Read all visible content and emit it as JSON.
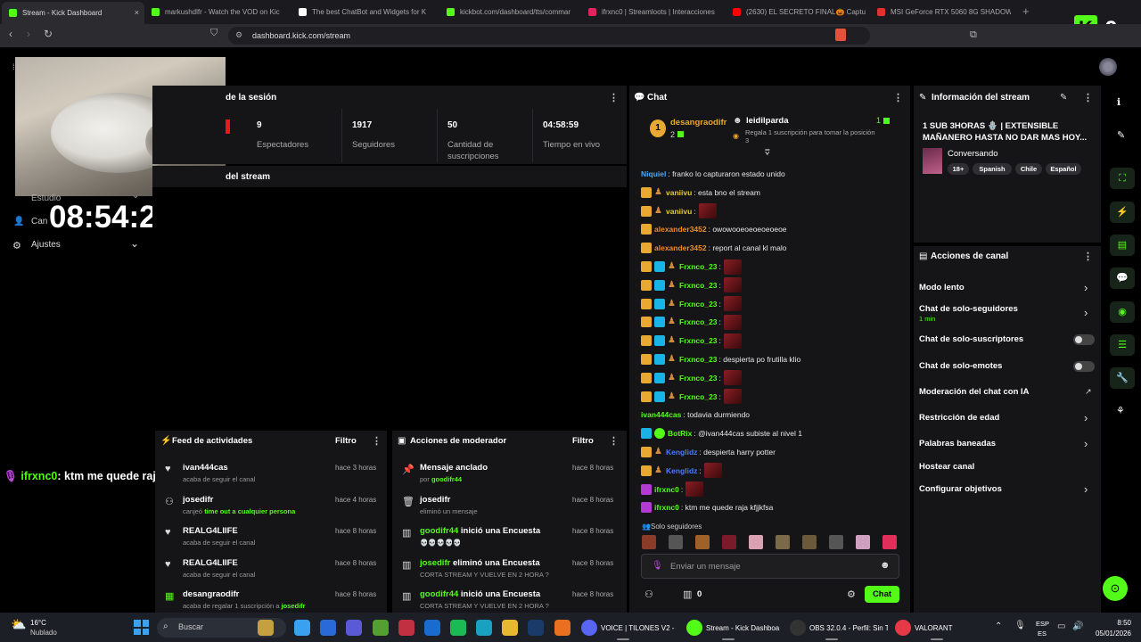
{
  "browser": {
    "tabs": [
      {
        "title": "Stream - Kick Dashboard",
        "color": "#53fc18"
      },
      {
        "title": "markushdlfr - Watch the VOD on Kic",
        "color": "#53fc18"
      },
      {
        "title": "The best ChatBot and Widgets for K",
        "color": "#ffffff"
      },
      {
        "title": "kickbot.com/dashboard/tts/commar",
        "color": "#53fc18"
      },
      {
        "title": "ifrxnc0 | Streamloots | Interacciones",
        "color": "#e0245e"
      },
      {
        "title": "(2630) EL SECRETO FINAL🎃 Captu",
        "color": "#ff0000"
      },
      {
        "title": "MSI GeForce RTX 5060 8G SHADOW",
        "color": "#e03030"
      }
    ],
    "tab_close": "×",
    "new_tab": "+",
    "url": "dashboard.kick.com/stream",
    "brand_icon_text": "K",
    "brand_number": "9"
  },
  "session": {
    "title": "de la sesión",
    "stats": [
      {
        "value": "9",
        "label": "Espectadores"
      },
      {
        "value": "1917",
        "label": "Seguidores"
      },
      {
        "value": "50",
        "label": "Cantidad de suscripciones"
      },
      {
        "value": "04:58:59",
        "label": "Tiempo en vivo"
      }
    ],
    "preview_title": "del stream"
  },
  "overlay": {
    "clock": "08:54:29",
    "left_menu": [
      {
        "label": "Estudio"
      },
      {
        "label": "Can"
      },
      {
        "label": "Ajustes"
      }
    ]
  },
  "overlay_chat_line": {
    "user": "ifrxnc0",
    "text": ": ktm me quede raja kfjjkfsa"
  },
  "chat": {
    "title": "Chat",
    "pinned": {
      "rank": "1",
      "user": "desangraodifr",
      "count": "2",
      "target": "leidilparda",
      "target_count": "1",
      "gift_text": "Regala 1 suscripción para tomar la posición 3"
    },
    "messages": [
      {
        "user": "Niquiel",
        "color": "#4aa8ff",
        "text": ": franko lo capturaron estado unido",
        "badges": []
      },
      {
        "user": "vaniivu",
        "color": "#e8c832",
        "text": ": esta bno el stream",
        "badges": [
          "crown",
          "fig"
        ]
      },
      {
        "user": "vaniivu",
        "color": "#e8c832",
        "text": ":",
        "badges": [
          "crown",
          "fig"
        ],
        "emote": true
      },
      {
        "user": "alexander3452",
        "color": "#f08a24",
        "text": ": owowooeoeoeoeoeoe",
        "badges": [
          "crown"
        ]
      },
      {
        "user": "alexander3452",
        "color": "#f08a24",
        "text": ": report al canal kl malo",
        "badges": [
          "crown"
        ]
      },
      {
        "user": "Frxnco_23",
        "color": "#53fc18",
        "text": ":",
        "badges": [
          "crown",
          "sub",
          "fig"
        ],
        "emote": true
      },
      {
        "user": "Frxnco_23",
        "color": "#53fc18",
        "text": ":",
        "badges": [
          "crown",
          "sub",
          "fig"
        ],
        "emote": true
      },
      {
        "user": "Frxnco_23",
        "color": "#53fc18",
        "text": ":",
        "badges": [
          "crown",
          "sub",
          "fig"
        ],
        "emote": true
      },
      {
        "user": "Frxnco_23",
        "color": "#53fc18",
        "text": ":",
        "badges": [
          "crown",
          "sub",
          "fig"
        ],
        "emote": true
      },
      {
        "user": "Frxnco_23",
        "color": "#53fc18",
        "text": ":",
        "badges": [
          "crown",
          "sub",
          "fig"
        ],
        "emote": true
      },
      {
        "user": "Frxnco_23",
        "color": "#53fc18",
        "text": ": despierta po frutilla klio",
        "badges": [
          "crown",
          "sub",
          "fig"
        ]
      },
      {
        "user": "Frxnco_23",
        "color": "#53fc18",
        "text": ":",
        "badges": [
          "crown",
          "sub",
          "fig"
        ],
        "emote": true
      },
      {
        "user": "Frxnco_23",
        "color": "#53fc18",
        "text": ":",
        "badges": [
          "crown",
          "sub",
          "fig"
        ],
        "emote": true
      },
      {
        "user": "ivan444cas",
        "color": "#53fc18",
        "text": ": todavia durmiendo",
        "badges": []
      },
      {
        "user": "BotRix",
        "color": "#53fc18",
        "text": ": @ivan444cas subiste al nivel 1",
        "badges": [
          "bot",
          "check"
        ]
      },
      {
        "user": "Kenglidz",
        "color": "#4a7aff",
        "text": ": despierta harry potter",
        "badges": [
          "crown",
          "fig"
        ]
      },
      {
        "user": "Kenglidz",
        "color": "#4a7aff",
        "text": ":",
        "badges": [
          "crown",
          "fig"
        ],
        "emote": true
      },
      {
        "user": "ifrxnc0",
        "color": "#53fc18",
        "text": ":",
        "badges": [
          "mic"
        ],
        "emote": true
      },
      {
        "user": "ifrxnc0",
        "color": "#53fc18",
        "text": ": ktm me quede raja kfjjkfsa",
        "badges": [
          "mic"
        ]
      }
    ],
    "followers_only": "Solo seguidores",
    "input_placeholder": "Enviar un mensaje",
    "points": "0",
    "send_label": "Chat"
  },
  "stream_info": {
    "title": "Información del stream",
    "stream_title": "1 SUB 3HORAS 🪬 | EXTENSIBLE MAÑANERO HASTA NO DAR MAS HOY...",
    "category": "Conversando",
    "tags": [
      "18+",
      "Spanish",
      "Chile",
      "Español"
    ]
  },
  "channel_actions": {
    "title": "Acciones de canal",
    "items": [
      {
        "label": "Modo lento",
        "control": "chevron"
      },
      {
        "label": "Chat de solo-seguidores",
        "sub": "1 min",
        "control": "chevron"
      },
      {
        "label": "Chat de solo-suscriptores",
        "control": "toggle"
      },
      {
        "label": "Chat de solo-emotes",
        "control": "toggle"
      },
      {
        "label": "Moderación del chat con IA",
        "control": "external"
      },
      {
        "label": "Restricción de edad",
        "control": "chevron"
      },
      {
        "label": "Palabras baneadas",
        "control": "chevron"
      },
      {
        "label": "Hostear canal",
        "control": "none"
      },
      {
        "label": "Configurar objetivos",
        "control": "chevron"
      }
    ]
  },
  "activity_feed": {
    "title": "Feed de actividades",
    "filter": "Filtro",
    "items": [
      {
        "icon": "heart",
        "name": "ivan444cas",
        "desc": "acaba de seguir el canal",
        "time": "hace 3 horas"
      },
      {
        "icon": "users",
        "name": "josedifr",
        "desc": "canjeó ",
        "highlight": "time out a cualquier persona",
        "time": "hace 4 horas"
      },
      {
        "icon": "heart",
        "name": "REALG4LIIFE",
        "desc": "acaba de seguir el canal",
        "time": "hace 8 horas"
      },
      {
        "icon": "heart",
        "name": "REALG4LIIFE",
        "desc": "acaba de seguir el canal",
        "time": "hace 8 horas"
      },
      {
        "icon": "gift",
        "name": "desangraodifr",
        "desc": "acaba de regalar 1 suscripción a ",
        "highlight": "josedifr",
        "time": "hace 8 horas"
      }
    ]
  },
  "mod_actions": {
    "title": "Acciones de moderador",
    "filter": "Filtro",
    "items": [
      {
        "icon": "pin",
        "name": "Mensaje anclado",
        "name_highlight": false,
        "desc": "por ",
        "highlight": "goodifr44",
        "time": "hace 8 horas"
      },
      {
        "icon": "trash",
        "name": "josedifr",
        "desc": "eliminó un mensaje",
        "time": "hace 8 horas"
      },
      {
        "icon": "poll",
        "name": "goodifr44",
        "action": " inició una Encuesta",
        "desc": "💀💀💀💀💀",
        "time": "hace 8 horas"
      },
      {
        "icon": "poll",
        "name": "josedifr",
        "action": " eliminó una Encuesta",
        "desc": "CORTA STREAM Y VUELVE EN 2 HORA ?",
        "time": "hace 8 horas"
      },
      {
        "icon": "poll",
        "name": "goodifr44",
        "action": " inició una Encuesta",
        "desc": "CORTA STREAM Y VUELVE EN 2 HORA ?",
        "time": "hace 8 horas"
      }
    ]
  },
  "taskbar": {
    "weather_temp": "16°C",
    "weather_desc": "Nublado",
    "search": "Buscar",
    "apps": [
      {
        "label": "VOICE | TILONES V2 - ",
        "color": "#5865f2"
      },
      {
        "label": "Stream - Kick Dashboa",
        "color": "#53fc18"
      },
      {
        "label": "OBS 32.0.4 - Perfil: Sin T",
        "color": "#333333"
      },
      {
        "label": "VALORANT",
        "color": "#e63946"
      }
    ],
    "lang_top": "ESP",
    "lang_bottom": "ES",
    "time": "8:50",
    "date": "05/01/2026"
  }
}
